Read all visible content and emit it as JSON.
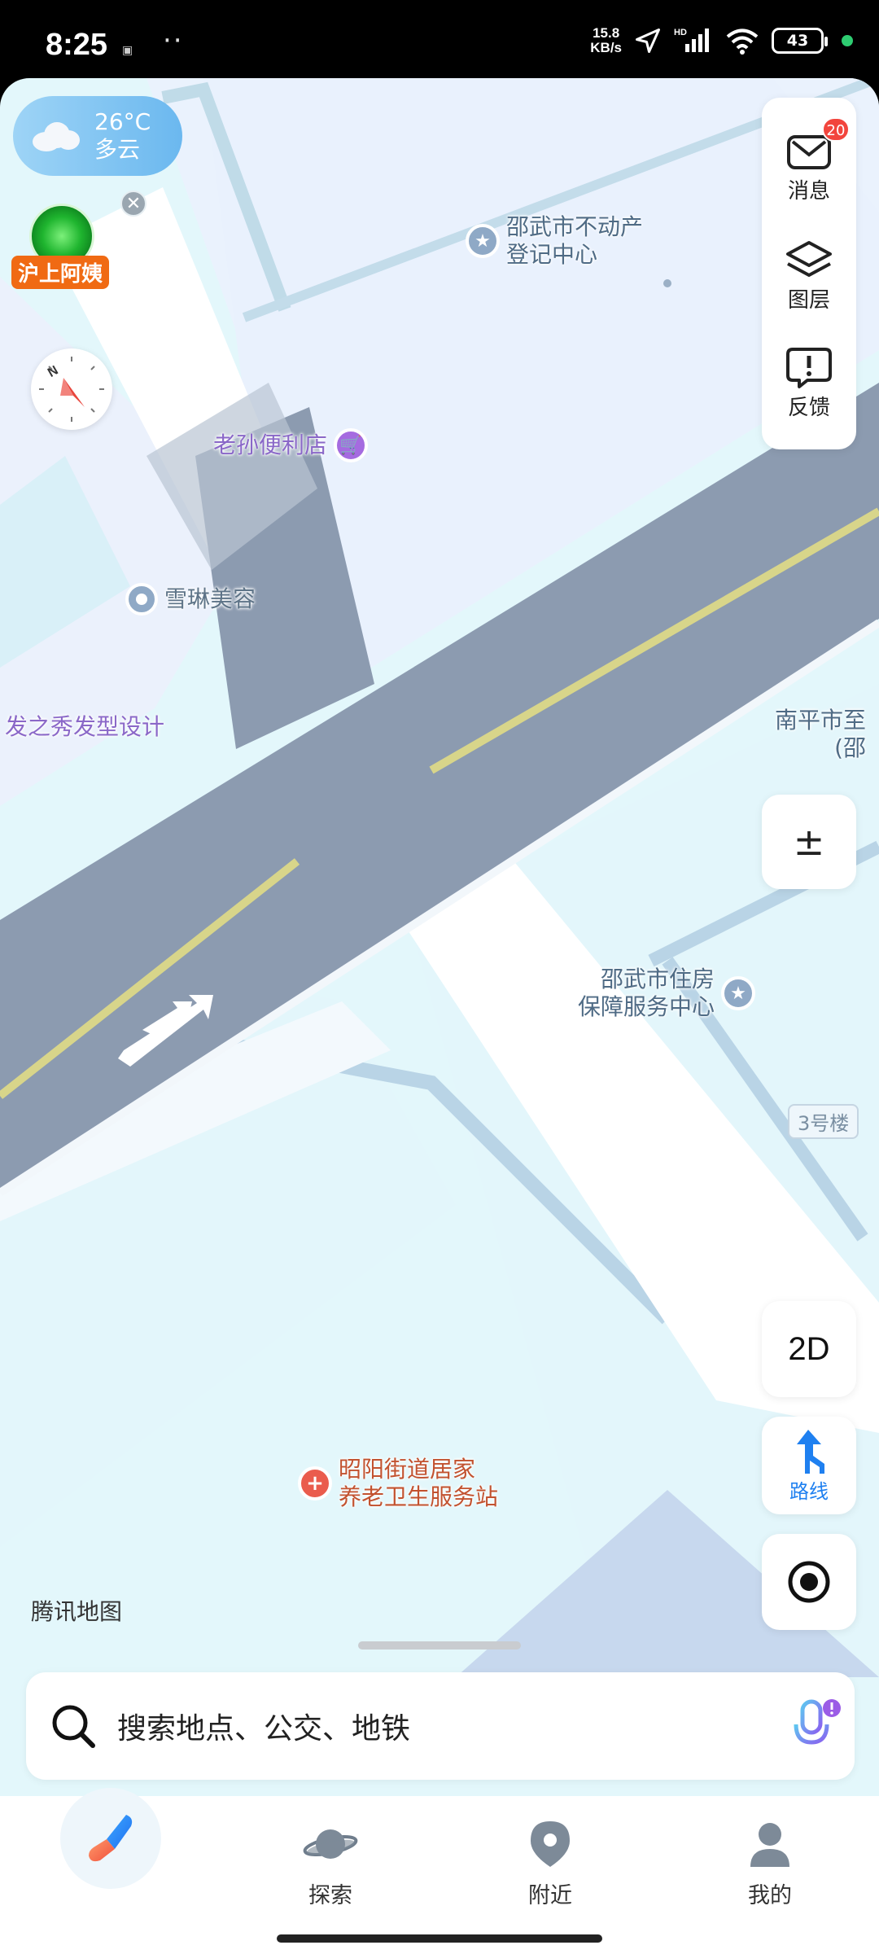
{
  "status_bar": {
    "time": "8:25",
    "net_speed_value": "15.8",
    "net_speed_unit": "KB/s",
    "battery": "43"
  },
  "weather": {
    "temperature": "26°C",
    "condition": "多云"
  },
  "badge": {
    "label": "沪上阿姨"
  },
  "compass": {
    "north": "N"
  },
  "right_panel": {
    "messages_label": "消息",
    "messages_count": "20",
    "layers_label": "图层",
    "feedback_label": "反馈"
  },
  "map_pois": {
    "real_estate_line1": "邵武市不动产",
    "real_estate_line2": "登记中心",
    "store": "老孙便利店",
    "beauty": "雪琳美容",
    "hair": "发之秀发型设计",
    "nanping_line1": "南平市至",
    "nanping_line2": "(邵",
    "housing_line1": "邵武市住房",
    "housing_line2": "保障服务中心",
    "building": "3号楼",
    "health_line1": "昭阳街道居家",
    "health_line2": "养老卫生服务站"
  },
  "map_controls": {
    "zoom_label": "±",
    "view_mode": "2D",
    "route_label": "路线"
  },
  "map_brand": "腾讯地图",
  "search": {
    "placeholder": "搜索地点、公交、地铁"
  },
  "bottom_nav": {
    "explore": "探索",
    "nearby": "附近",
    "mine": "我的"
  },
  "colors": {
    "accent_blue": "#1f80f0",
    "road": "#8c9bb0",
    "map_bg": "#e3f7fb",
    "badge_orange": "#f06a13",
    "notification_red": "#f2453d"
  }
}
